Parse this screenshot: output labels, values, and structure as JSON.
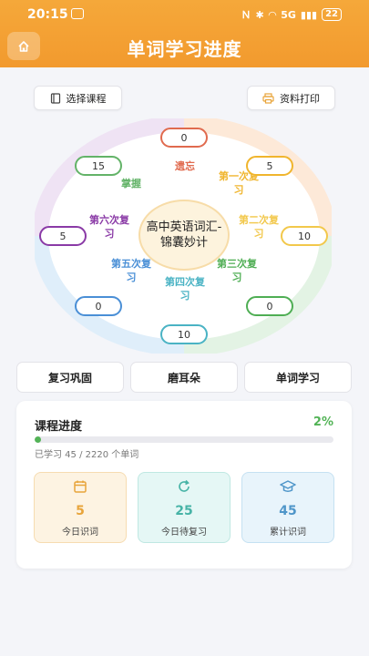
{
  "status": {
    "time": "20:15",
    "net": "5G",
    "battery": "22"
  },
  "header": {
    "title": "单词学习进度"
  },
  "actions": {
    "select_course": "选择课程",
    "print": "资料打印"
  },
  "wheel": {
    "center": "高中英语词汇-锦囊妙计",
    "stages": [
      {
        "label": "遗忘",
        "count": "0",
        "color": "#e06a4e"
      },
      {
        "label": "第一次复习",
        "count": "5",
        "color": "#f0b52d"
      },
      {
        "label": "第二次复习",
        "count": "10",
        "color": "#f2c84b"
      },
      {
        "label": "第三次复习",
        "count": "0",
        "color": "#4fae54"
      },
      {
        "label": "第四次复习",
        "count": "10",
        "color": "#4ab3c4"
      },
      {
        "label": "第五次复习",
        "count": "0",
        "color": "#4a8fd6"
      },
      {
        "label": "第六次复习",
        "count": "5",
        "color": "#8a3aa6"
      },
      {
        "label": "掌握",
        "count": "15",
        "color": "#63b368"
      }
    ]
  },
  "tabs": [
    "复习巩固",
    "磨耳朵",
    "单词学习"
  ],
  "progress": {
    "title": "课程进度",
    "percent_label": "2%",
    "fraction": 0.02,
    "learned_text": "已学习 45 / 2220 个单词"
  },
  "stats": [
    {
      "value": "5",
      "label": "今日识词",
      "color": "#e8a43a",
      "bg": "#fdf3e2",
      "border": "#f6dcb1",
      "icon": "calendar-icon"
    },
    {
      "value": "25",
      "label": "今日待复习",
      "color": "#46b3a6",
      "bg": "#e5f7f5",
      "border": "#bfe8e2",
      "icon": "refresh-icon"
    },
    {
      "value": "45",
      "label": "累计识词",
      "color": "#4f96c9",
      "bg": "#e8f4fb",
      "border": "#c5e1f2",
      "icon": "graduation-cap-icon"
    }
  ]
}
